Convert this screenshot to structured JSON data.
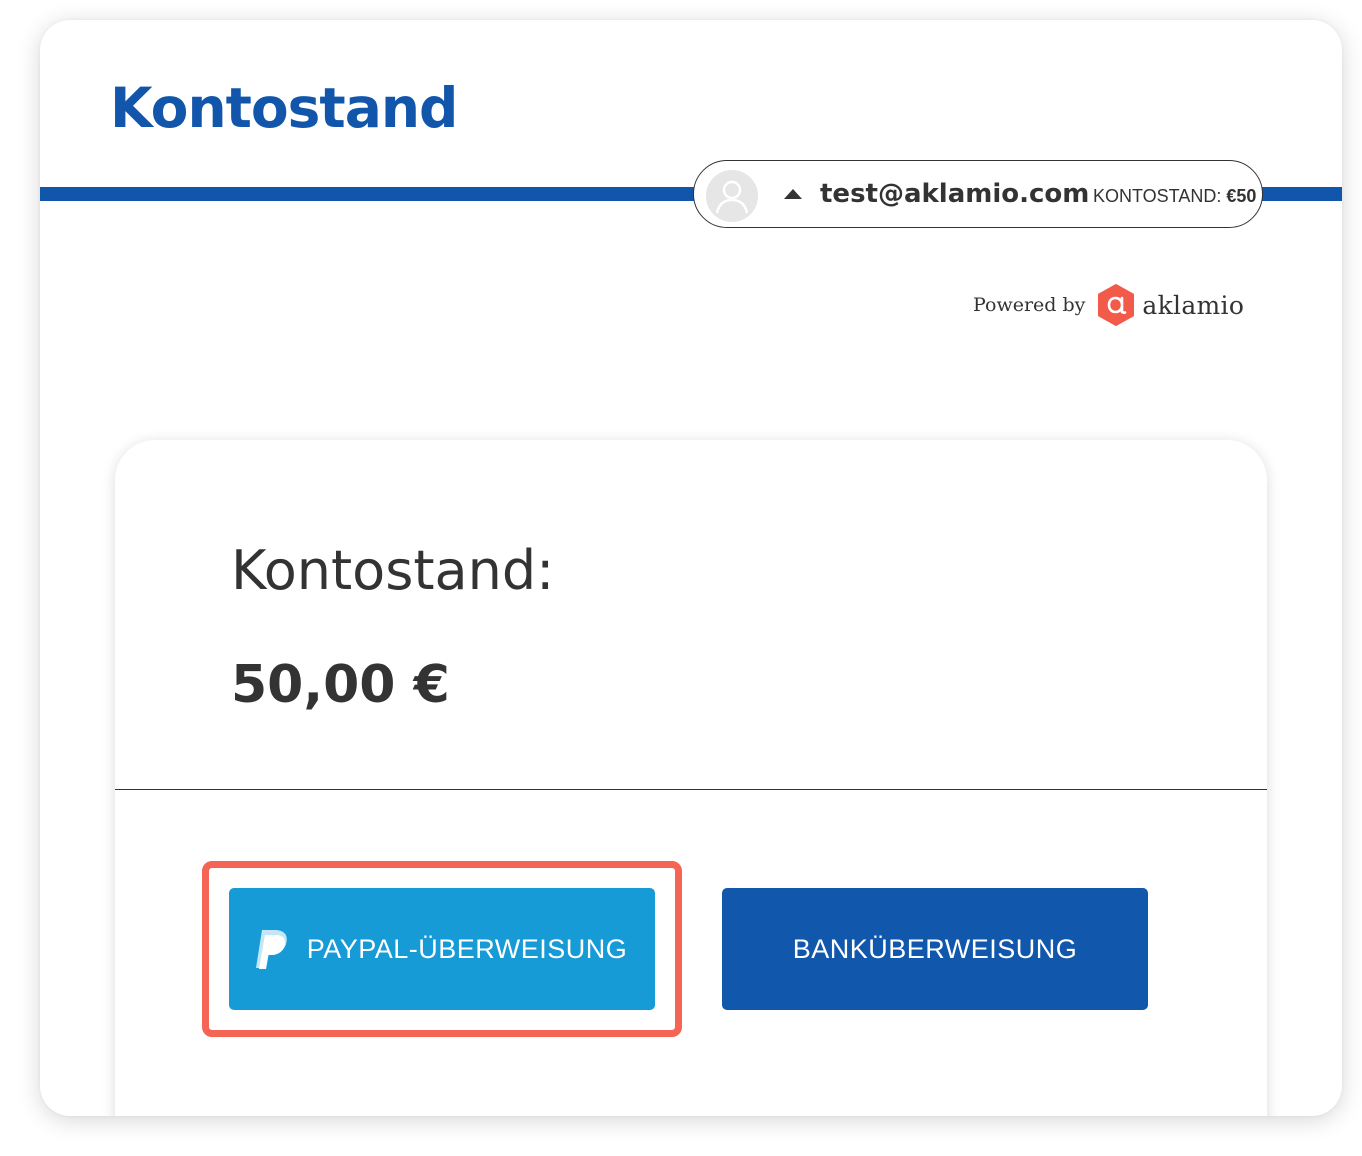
{
  "header": {
    "title": "Kontostand"
  },
  "account": {
    "email": "test@aklamio.com",
    "balance_label": "KONTOSTAND:",
    "balance_value": "€50"
  },
  "powered": {
    "text": "Powered by",
    "brand": "aklamio"
  },
  "card": {
    "label": "Kontostand:",
    "amount": "50,00 €",
    "paypal_button": "PAYPAL-ÜBERWEISUNG",
    "bank_button": "BANKÜBERWEISUNG"
  },
  "icons": {
    "avatar": "user-avatar-icon",
    "caret": "caret-up-icon",
    "brand_logo": "aklamio-logo-icon",
    "paypal": "paypal-icon"
  },
  "colors": {
    "brand_blue": "#1156ab",
    "paypal_blue": "#179bd7",
    "bank_blue": "#1158ad",
    "highlight": "#f46555",
    "logo_red": "#f25a4a",
    "text": "#333333"
  }
}
